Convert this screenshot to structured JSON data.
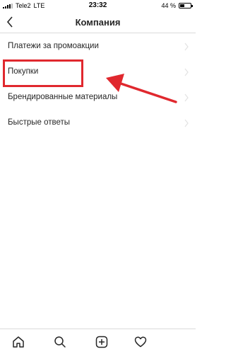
{
  "status_bar": {
    "carrier": "Tele2",
    "network": "LTE",
    "time": "23:32",
    "battery": "44 %",
    "battery_level": 0.44
  },
  "header": {
    "title": "Компания",
    "back_icon": "chevron-left-icon"
  },
  "menu": {
    "items": [
      {
        "label": "Платежи за промоакции"
      },
      {
        "label": "Покупки"
      },
      {
        "label": "Брендированные материалы"
      },
      {
        "label": "Быстрые ответы"
      }
    ]
  },
  "annotation": {
    "color": "#e0282e",
    "highlighted_item": "Покупки"
  },
  "tab_bar": {
    "icons": [
      "home-icon",
      "search-icon",
      "add-post-icon",
      "heart-icon"
    ]
  }
}
